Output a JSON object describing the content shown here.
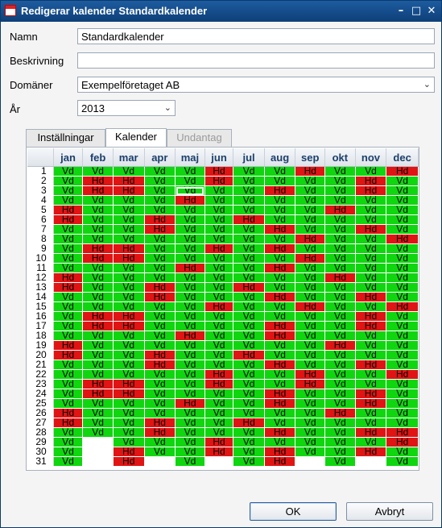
{
  "window": {
    "title": "Redigerar kalender Standardkalender"
  },
  "form": {
    "name_label": "Namn",
    "name_value": "Standardkalender",
    "desc_label": "Beskrivning",
    "desc_value": "",
    "domain_label": "Domäner",
    "domain_value": "Exempelföretaget AB",
    "year_label": "År",
    "year_value": "2013"
  },
  "tabs": [
    {
      "label": "Inställningar",
      "state": "normal"
    },
    {
      "label": "Kalender",
      "state": "active"
    },
    {
      "label": "Undantag",
      "state": "disabled"
    }
  ],
  "calendar": {
    "months": [
      "jan",
      "feb",
      "mar",
      "apr",
      "maj",
      "jun",
      "jul",
      "aug",
      "sep",
      "okt",
      "nov",
      "dec"
    ],
    "days": [
      "1",
      "2",
      "3",
      "4",
      "5",
      "6",
      "7",
      "8",
      "9",
      "10",
      "11",
      "12",
      "13",
      "14",
      "15",
      "16",
      "17",
      "18",
      "19",
      "20",
      "21",
      "22",
      "23",
      "24",
      "25",
      "26",
      "27",
      "28",
      "29",
      "30",
      "31"
    ],
    "labels": {
      "V": "Vd",
      "H": "Hd"
    },
    "colors": {
      "vd": "#10d610",
      "hd": "#e11414"
    },
    "selected": {
      "day": 3,
      "month": "maj"
    },
    "grid": [
      "VVVVVHVVHVVH",
      "VHHVVHVVVVHV",
      "VHHVVVVHVVHV",
      "VVVVHVVVVVVV",
      "HVVVVVVVVHVV",
      "HVVHVVHVVVVV",
      "VVVHVVVHVVHV",
      "VVVVVVVVHVVH",
      "VHHVVHVHVVVV",
      "VHHVVVVVHVVV",
      "VVVVHVVHVVVV",
      "HVVVVVVVVHVV",
      "HVVHVVHVVVVV",
      "VVVHVVVHVVHV",
      "VVVVVHVVHVVH",
      "VHHVVVVVVVHV",
      "VHHVVVVHVVHV",
      "VVVVHVVHVVVV",
      "HVVVVVVVVHVV",
      "HVVHVVHVVVVV",
      "VVVHVVVHVVHV",
      "VVVVVHVVHVVH",
      "VHHVVHVVHVVV",
      "VHHVVVVHVVHV",
      "VVVVHVVHVVHV",
      "HVVVVVVVVHVV",
      "HVVHVVHVVVVV",
      "VVVHVVVHVVHH",
      "V-VVVHVVVVVH",
      "V-HVVHVHVVHV",
      "V-H-V-VH-V-V"
    ]
  },
  "buttons": {
    "ok": "OK",
    "cancel": "Avbryt"
  }
}
